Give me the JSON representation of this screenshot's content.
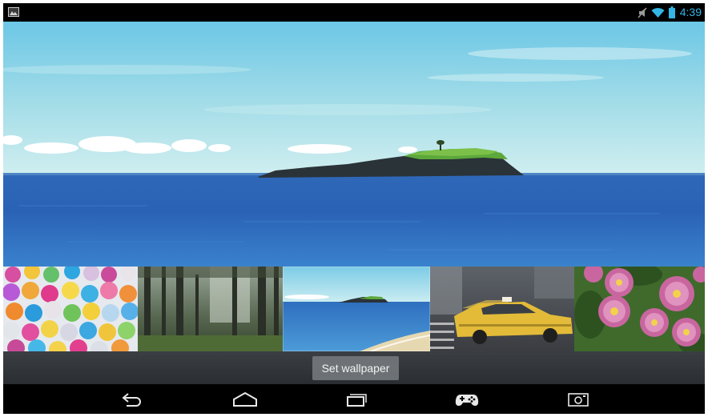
{
  "status_bar": {
    "time": "4:39",
    "left_icon": "gallery-notification-icon",
    "right_icons": [
      "mute-icon",
      "wifi-icon",
      "battery-icon"
    ]
  },
  "wallpaper_preview": {
    "description_icon": "island-seascape-wallpaper"
  },
  "thumbnails": [
    {
      "name": "balloons-thumbnail"
    },
    {
      "name": "forest-thumbnail"
    },
    {
      "name": "island-thumbnail",
      "selected": true
    },
    {
      "name": "taxi-thumbnail"
    },
    {
      "name": "flowers-thumbnail"
    }
  ],
  "action": {
    "set_wallpaper_label": "Set wallpaper"
  },
  "nav_bar": {
    "buttons": [
      "back-icon",
      "home-icon",
      "recents-icon",
      "game-icon",
      "screenshot-icon"
    ]
  },
  "colors": {
    "clock": "#33b5e5",
    "accent": "#33b5e5",
    "background": "#000000"
  }
}
